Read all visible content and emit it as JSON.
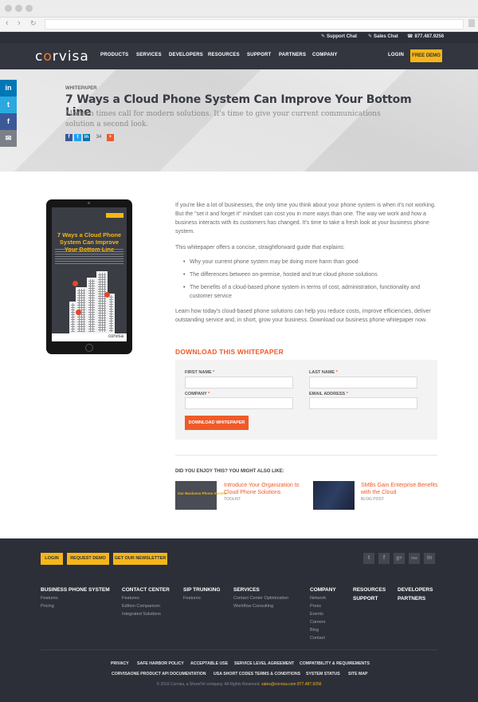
{
  "utility_bar": {
    "support_chat": "Support Chat",
    "sales_chat": "Sales Chat",
    "phone": "877.487.9256"
  },
  "nav": {
    "logo_pre": "c",
    "logo_o": "o",
    "logo_post": "rvisa",
    "items": [
      "PRODUCTS",
      "SERVICES",
      "DEVELOPERS",
      "RESOURCES",
      "SUPPORT",
      "PARTNERS",
      "COMPANY"
    ],
    "login": "LOGIN",
    "free_demo": "FREE DEMO"
  },
  "hero": {
    "kicker": "WHITEPAPER",
    "title": "7 Ways a Cloud Phone System Can Improve Your Bottom Line",
    "subtitle": "Modern times call for modern solutions. It's time to give your current communications solution a second look.",
    "share_count": "34"
  },
  "social_rail": [
    "in",
    "t",
    "f",
    "✉"
  ],
  "tablet": {
    "cover_title": "7 Ways a Cloud Phone System Can Improve Your Bottom Line",
    "footer_brand": "corvisa"
  },
  "content": {
    "p1": "If you're like a lot of businesses, the only time you think about your phone system is when it's not working. But the \"set it and forget it\" mindset can cost you in more ways than one. The way we work and how a business interacts with its customers has changed. It's time to take a fresh look at your business phone system.",
    "p2": "This whitepaper offers a concise, straightforward guide that explains:",
    "bullets": [
      "Why your current phone system may be doing more harm than good",
      "The differences between on-premise, hosted and true cloud phone solutions",
      "The benefits of a cloud-based phone system in terms of cost, administration, functionality and customer service"
    ],
    "p3": "Learn how today's cloud-based phone solutions can help you reduce costs, improve efficiencies, deliver outstanding service and, in short, grow your business. Download our business phone whitepaper now."
  },
  "download": {
    "title": "DOWNLOAD THIS WHITEPAPER",
    "first_name": "FIRST NAME",
    "last_name": "LAST NAME",
    "company": "COMPANY",
    "email": "EMAIL ADDRESS",
    "required_mark": "*",
    "button": "DOWNLOAD WHITEPAPER"
  },
  "related": {
    "heading": "DID YOU ENJOY THIS? YOU MIGHT ALSO LIKE:",
    "items": [
      {
        "title": "Introduce Your Organization to Cloud Phone Solutions",
        "type": "TOOLKIT",
        "thumb_text": "Our Business Phone System"
      },
      {
        "title": "SMBs Gain Enterprise Benefits with the Cloud",
        "type": "BLOG POST"
      }
    ]
  },
  "footer": {
    "buttons": [
      "LOGIN",
      "REQUEST DEMO",
      "GET OUR NEWSLETTER"
    ],
    "social": [
      "t",
      "f",
      "g+",
      "rss",
      "in"
    ],
    "columns": [
      {
        "heading": "BUSINESS PHONE SYSTEM",
        "items": [
          "Features",
          "Pricing"
        ]
      },
      {
        "heading": "CONTACT CENTER",
        "items": [
          "Features",
          "Edition Comparison",
          "Integrated Solutions"
        ]
      },
      {
        "heading": "SIP TRUNKING",
        "items": [
          "Features"
        ]
      },
      {
        "heading": "SERVICES",
        "items": [
          "Contact Center Optimization",
          "Workflow Consulting"
        ]
      },
      {
        "heading": "COMPANY",
        "items": [
          "Network",
          "Press",
          "Events",
          "Careers",
          "Blog",
          "Contact"
        ]
      },
      {
        "heading": "RESOURCES",
        "items": []
      },
      {
        "heading": "DEVELOPERS",
        "items": []
      }
    ],
    "extra_headings": [
      "SUPPORT",
      "PARTNERS"
    ],
    "links_row1": [
      "PRIVACY",
      "SAFE HARBOR POLICY",
      "ACCEPTABLE USE",
      "SERVICE LEVEL AGREEMENT",
      "COMPATIBILITY & REQUIREMENTS"
    ],
    "links_row2": [
      "CORVISAONE PRODUCT API DOCUMENTATION",
      "USA SHORT CODES TERMS & CONDITIONS",
      "SYSTEM STATUS",
      "SITE MAP"
    ],
    "copyright": "© 2016 Corvisa, a ShoreTel company. All Rights Reserved.",
    "email": "sales@corvisa.com",
    "phone": "877.487.9256"
  },
  "colors": {
    "accent_orange": "#f05a28",
    "accent_yellow": "#f5b619",
    "nav_dark": "#33363f",
    "footer_dark": "#2c2f38"
  }
}
